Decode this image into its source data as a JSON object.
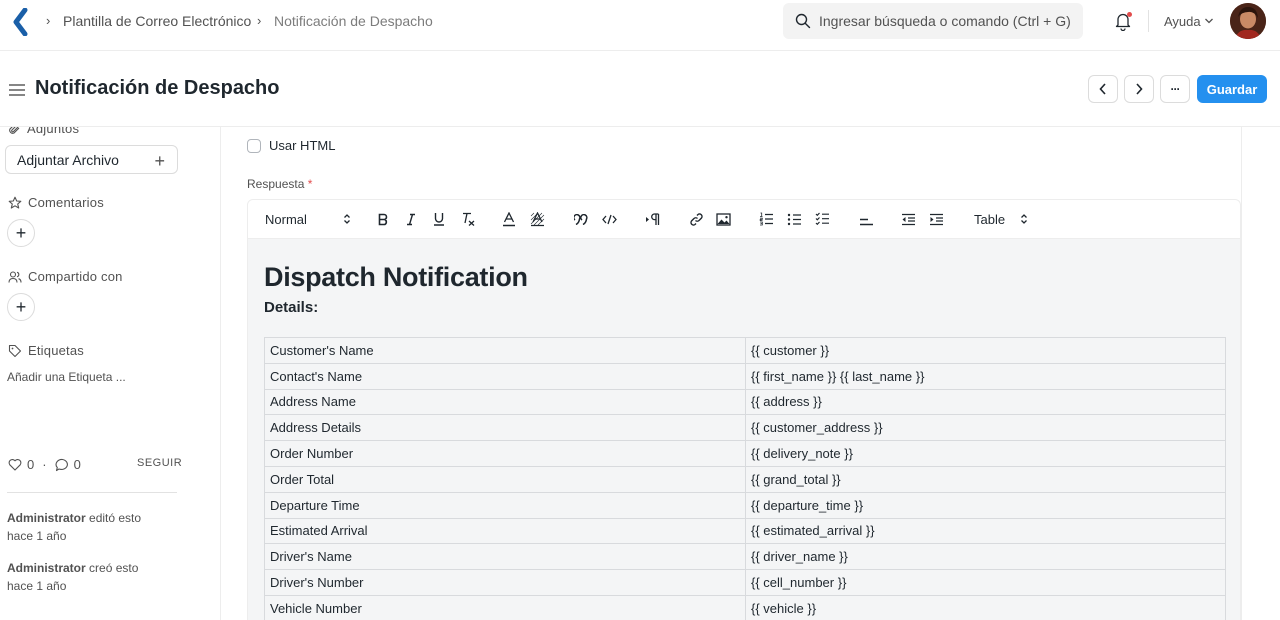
{
  "navbar": {
    "breadcrumbs": [
      "Plantilla de Correo Electrónico",
      "Notificación de Despacho"
    ],
    "search_placeholder": "Ingresar búsqueda o comando (Ctrl + G)",
    "help_label": "Ayuda"
  },
  "header": {
    "title": "Notificación de Despacho",
    "save_label": "Guardar",
    "more_label": "···"
  },
  "sidebar": {
    "attachments_label": "Adjuntos",
    "attach_button_label": "Adjuntar Archivo",
    "comments_label": "Comentarios",
    "shared_label": "Compartido con",
    "tags_label": "Etiquetas",
    "add_tag_label": "Añadir una Etiqueta ...",
    "likes_count": "0",
    "comments_count": "0",
    "follow_label": "SEGUIR",
    "activity": [
      {
        "user": "Administrator",
        "action": "editó esto",
        "time": "hace 1 año"
      },
      {
        "user": "Administrator",
        "action": "creó esto",
        "time": "hace 1 año"
      }
    ]
  },
  "form": {
    "use_html_label": "Usar HTML",
    "response_label": "Respuesta",
    "required_marker": "*"
  },
  "toolbar": {
    "paragraph_style": "Normal",
    "table_label": "Table"
  },
  "document": {
    "title": "Dispatch Notification",
    "subtitle": "Details:",
    "rows": [
      [
        "Customer's Name",
        "{{ customer }}"
      ],
      [
        "Contact's Name",
        "{{ first_name }} {{ last_name }}"
      ],
      [
        "Address Name",
        "{{ address }}"
      ],
      [
        "Address Details",
        "{{ customer_address }}"
      ],
      [
        "Order Number",
        "{{ delivery_note }}"
      ],
      [
        "Order Total",
        "{{ grand_total }}"
      ],
      [
        "Departure Time",
        "{{ departure_time }}"
      ],
      [
        "Estimated Arrival",
        "{{ estimated_arrival }}"
      ],
      [
        "Driver's Name",
        "{{ driver_name }}"
      ],
      [
        "Driver's Number",
        "{{ cell_number }}"
      ],
      [
        "Vehicle Number",
        "{{ vehicle }}"
      ]
    ]
  },
  "colors": {
    "primary": "#2490ef",
    "logo": "#1a5fa8",
    "notification_dot": "#e24c4c"
  }
}
